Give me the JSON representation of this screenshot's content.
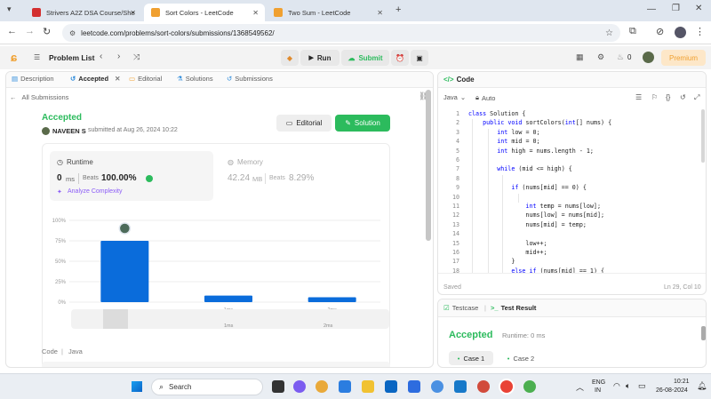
{
  "browser": {
    "tabs": [
      {
        "title": "Strivers A2Z DSA Course/Sheet",
        "color": "#d32f2f",
        "active": false
      },
      {
        "title": "Sort Colors - LeetCode",
        "color": "#f0a030",
        "active": true
      },
      {
        "title": "Two Sum - LeetCode",
        "color": "#f0a030",
        "active": false
      }
    ],
    "url": "leetcode.com/problems/sort-colors/submissions/1368549562/"
  },
  "lc_header": {
    "problem_list": "Problem List",
    "run": "Run",
    "submit": "Submit",
    "streak": "0",
    "premium": "Premium"
  },
  "left_tabs": [
    "Description",
    "Accepted",
    "Editorial",
    "Solutions",
    "Submissions"
  ],
  "submission": {
    "back": "All Submissions",
    "status": "Accepted",
    "user": "NAVEEN S",
    "submitted": "submitted at Aug 26, 2024 10:22",
    "editorial_btn": "Editorial",
    "solution_btn": "Solution",
    "runtime_label": "Runtime",
    "runtime_value": "0",
    "runtime_unit": "ms",
    "beats": "Beats",
    "runtime_beats": "100.00%",
    "analyze": "Analyze Complexity",
    "memory_label": "Memory",
    "memory_value": "42.24",
    "memory_unit": "MB",
    "memory_beats": "8.29%",
    "code_label": "Code",
    "lang": "Java"
  },
  "chart_data": {
    "type": "bar",
    "categories": [
      "",
      "1ms",
      "2ms"
    ],
    "values": [
      75,
      8,
      6
    ],
    "yticks": [
      "100%",
      "75%",
      "50%",
      "25%",
      "0%"
    ],
    "ylim": [
      0,
      100
    ],
    "color": "#0a6cdb",
    "minimap_labels": [
      "1ms",
      "2ms"
    ]
  },
  "editor": {
    "title": "Code",
    "lang": "Java",
    "mode": "Auto",
    "saved": "Saved",
    "cursor": "Ln 29, Col 10",
    "lines": [
      "class Solution {",
      "    public void sortColors(int[] nums) {",
      "        int low = 0;",
      "        int mid = 0;",
      "        int high = nums.length - 1;",
      "",
      "        while (mid <= high) {",
      "",
      "            if (nums[mid] == 0) {",
      "",
      "                int temp = nums[low];",
      "                nums[low] = nums[mid];",
      "                nums[mid] = temp;",
      "",
      "                low++;",
      "                mid++;",
      "            }",
      "            else if (nums[mid] == 1) {"
    ]
  },
  "testpanel": {
    "testcase": "Testcase",
    "result": "Test Result",
    "status": "Accepted",
    "runtime": "Runtime: 0 ms",
    "case1": "Case 1",
    "case2": "Case 2"
  },
  "taskbar": {
    "search": "Search",
    "lang1": "ENG",
    "lang2": "IN",
    "time": "10:21",
    "date": "26-08-2024"
  }
}
